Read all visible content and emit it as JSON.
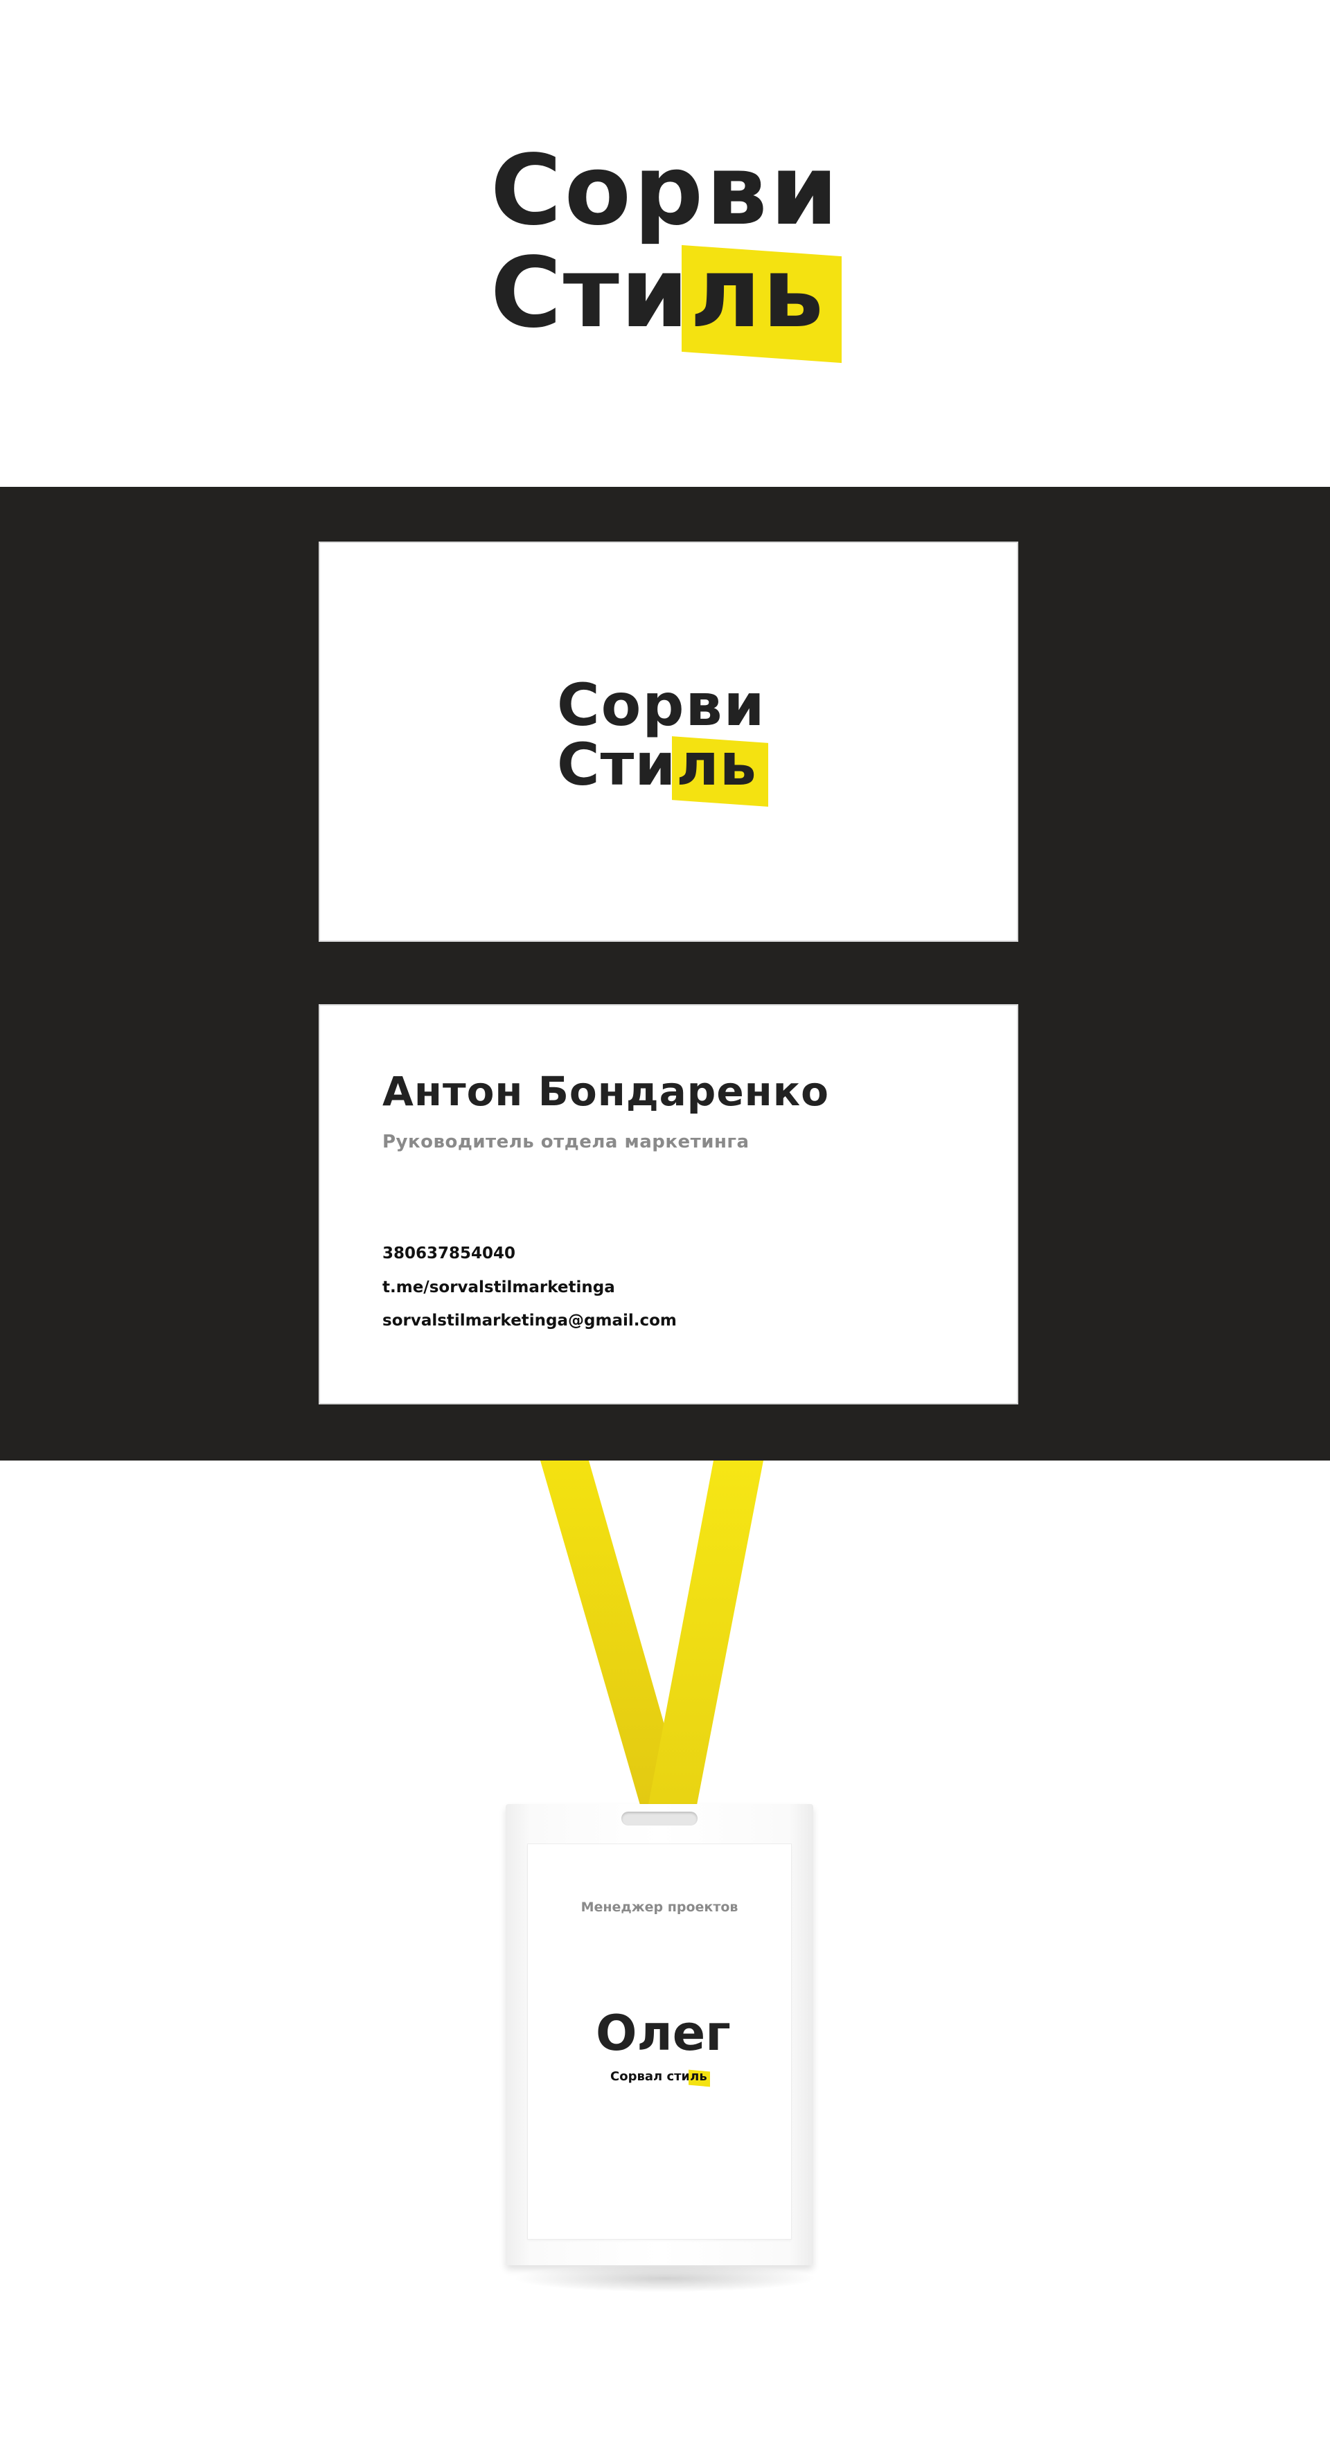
{
  "brand": {
    "logo_line1": "Сорви",
    "logo_line2_plain": "Сти",
    "logo_line2_highlight": "ль",
    "highlight_color": "#f4e211",
    "text_color": "#222222"
  },
  "business_card_front": {
    "logo_line1": "Сорви",
    "logo_line2_plain": "Сти",
    "logo_line2_highlight": "ль"
  },
  "business_card_back": {
    "name": "Антон Бондаренко",
    "title": "Руководитель отдела маркетинга",
    "phone": "380637854040",
    "telegram": "t.me/sorvalstilmarketinga",
    "email": "sorvalstilmarketinga@gmail.com"
  },
  "badge": {
    "role": "Менеджер проектов",
    "name": "Олег",
    "brand_plain": "Сорвал сти",
    "brand_highlight": "ль"
  },
  "colors": {
    "background": "#ffffff",
    "dark_band": "#232220",
    "lanyard": "#f4e211"
  },
  "icons": {
    "lanyard": "lanyard-strap-icon"
  }
}
